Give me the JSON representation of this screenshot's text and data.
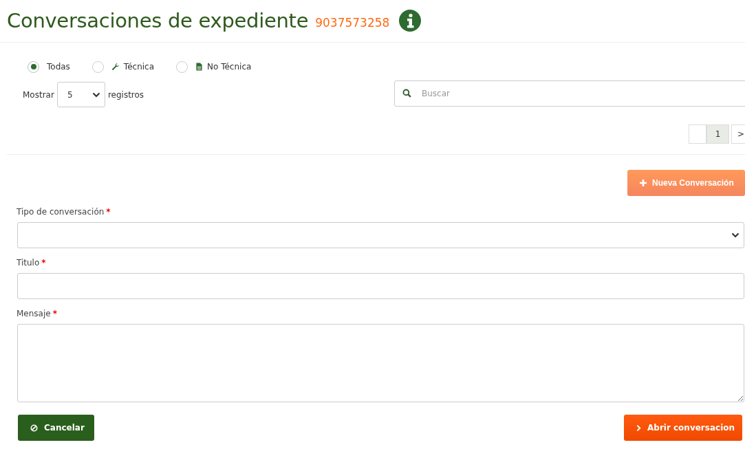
{
  "header": {
    "title": "Conversaciones de expediente",
    "record_number": "9037573258"
  },
  "filters": [
    {
      "label": "Todas",
      "kind": "all",
      "selected": true
    },
    {
      "label": "Técnica",
      "kind": "technical",
      "selected": false
    },
    {
      "label": "No Técnica",
      "kind": "non_technical",
      "selected": false
    }
  ],
  "page_size": {
    "prefix": "Mostrar",
    "value": "5",
    "suffix": "registros"
  },
  "search": {
    "placeholder": "Buscar"
  },
  "pagination": [
    {
      "selected": false
    },
    {
      "label": "1",
      "selected": true
    },
    {
      "label": ">",
      "selected": false
    }
  ],
  "new_button": "Nueva Conversación",
  "form": [
    {
      "kind": "select",
      "label": "Tipo de conversación",
      "required": true
    },
    {
      "kind": "text",
      "label": "Titulo",
      "required": true
    },
    {
      "kind": "textarea",
      "label": "Mensaje",
      "required": true
    }
  ],
  "required_mark": "*",
  "buttons": {
    "cancel": "Cancelar",
    "submit": "Abrir conversacion"
  }
}
